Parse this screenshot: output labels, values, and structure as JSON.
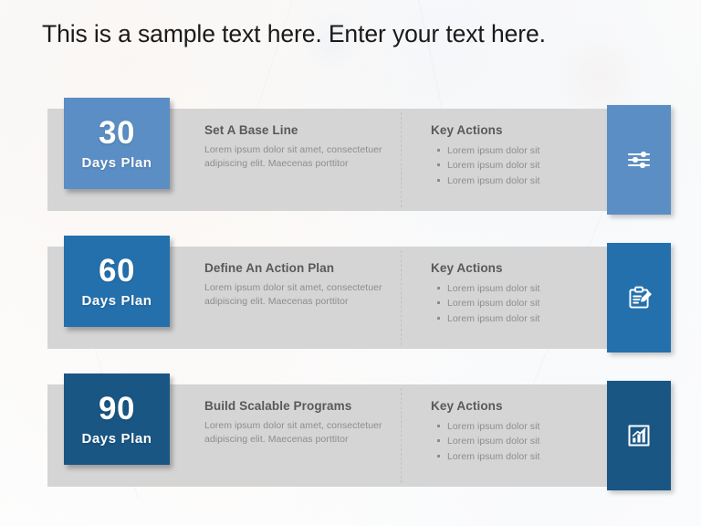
{
  "slide": {
    "title": "This is a sample text here. Enter your text here.",
    "background_color": "#fdfdfd",
    "bar_color": "#d5d5d5"
  },
  "rows": [
    {
      "number": "30",
      "subtitle": "Days Plan",
      "heading": "Set A Base Line",
      "description": "Lorem ipsum dolor sit amet, consectetuer adipiscing  elit. Maecenas porttitor",
      "key_actions_title": "Key Actions",
      "key_actions": [
        "Lorem ipsum  dolor sit",
        "Lorem ipsum  dolor sit",
        "Lorem ipsum  dolor sit"
      ],
      "accent_color": "#5b8ec4",
      "icon": "sliders-icon"
    },
    {
      "number": "60",
      "subtitle": "Days Plan",
      "heading": "Define An Action Plan",
      "description": "Lorem ipsum dolor sit amet, consectetuer adipiscing  elit. Maecenas porttitor",
      "key_actions_title": "Key Actions",
      "key_actions": [
        "Lorem ipsum  dolor sit",
        "Lorem ipsum  dolor sit",
        "Lorem ipsum  dolor sit"
      ],
      "accent_color": "#2470ac",
      "icon": "clipboard-pencil-icon"
    },
    {
      "number": "90",
      "subtitle": "Days Plan",
      "heading": "Build Scalable Programs",
      "description": "Lorem ipsum dolor sit amet, consectetuer adipiscing  elit. Maecenas porttitor",
      "key_actions_title": "Key Actions",
      "key_actions": [
        "Lorem ipsum  dolor sit",
        "Lorem ipsum  dolor sit",
        "Lorem ipsum  dolor sit"
      ],
      "accent_color": "#195684",
      "icon": "bar-chart-growth-icon"
    }
  ]
}
